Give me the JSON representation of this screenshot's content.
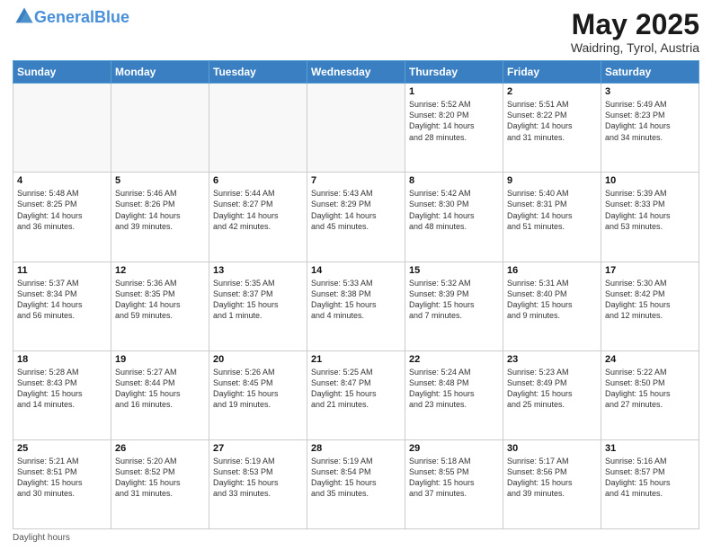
{
  "logo": {
    "line1": "General",
    "line2": "Blue"
  },
  "title": "May 2025",
  "subtitle": "Waidring, Tyrol, Austria",
  "days_of_week": [
    "Sunday",
    "Monday",
    "Tuesday",
    "Wednesday",
    "Thursday",
    "Friday",
    "Saturday"
  ],
  "weeks": [
    [
      {
        "day": "",
        "text": ""
      },
      {
        "day": "",
        "text": ""
      },
      {
        "day": "",
        "text": ""
      },
      {
        "day": "",
        "text": ""
      },
      {
        "day": "1",
        "text": "Sunrise: 5:52 AM\nSunset: 8:20 PM\nDaylight: 14 hours\nand 28 minutes."
      },
      {
        "day": "2",
        "text": "Sunrise: 5:51 AM\nSunset: 8:22 PM\nDaylight: 14 hours\nand 31 minutes."
      },
      {
        "day": "3",
        "text": "Sunrise: 5:49 AM\nSunset: 8:23 PM\nDaylight: 14 hours\nand 34 minutes."
      }
    ],
    [
      {
        "day": "4",
        "text": "Sunrise: 5:48 AM\nSunset: 8:25 PM\nDaylight: 14 hours\nand 36 minutes."
      },
      {
        "day": "5",
        "text": "Sunrise: 5:46 AM\nSunset: 8:26 PM\nDaylight: 14 hours\nand 39 minutes."
      },
      {
        "day": "6",
        "text": "Sunrise: 5:44 AM\nSunset: 8:27 PM\nDaylight: 14 hours\nand 42 minutes."
      },
      {
        "day": "7",
        "text": "Sunrise: 5:43 AM\nSunset: 8:29 PM\nDaylight: 14 hours\nand 45 minutes."
      },
      {
        "day": "8",
        "text": "Sunrise: 5:42 AM\nSunset: 8:30 PM\nDaylight: 14 hours\nand 48 minutes."
      },
      {
        "day": "9",
        "text": "Sunrise: 5:40 AM\nSunset: 8:31 PM\nDaylight: 14 hours\nand 51 minutes."
      },
      {
        "day": "10",
        "text": "Sunrise: 5:39 AM\nSunset: 8:33 PM\nDaylight: 14 hours\nand 53 minutes."
      }
    ],
    [
      {
        "day": "11",
        "text": "Sunrise: 5:37 AM\nSunset: 8:34 PM\nDaylight: 14 hours\nand 56 minutes."
      },
      {
        "day": "12",
        "text": "Sunrise: 5:36 AM\nSunset: 8:35 PM\nDaylight: 14 hours\nand 59 minutes."
      },
      {
        "day": "13",
        "text": "Sunrise: 5:35 AM\nSunset: 8:37 PM\nDaylight: 15 hours\nand 1 minute."
      },
      {
        "day": "14",
        "text": "Sunrise: 5:33 AM\nSunset: 8:38 PM\nDaylight: 15 hours\nand 4 minutes."
      },
      {
        "day": "15",
        "text": "Sunrise: 5:32 AM\nSunset: 8:39 PM\nDaylight: 15 hours\nand 7 minutes."
      },
      {
        "day": "16",
        "text": "Sunrise: 5:31 AM\nSunset: 8:40 PM\nDaylight: 15 hours\nand 9 minutes."
      },
      {
        "day": "17",
        "text": "Sunrise: 5:30 AM\nSunset: 8:42 PM\nDaylight: 15 hours\nand 12 minutes."
      }
    ],
    [
      {
        "day": "18",
        "text": "Sunrise: 5:28 AM\nSunset: 8:43 PM\nDaylight: 15 hours\nand 14 minutes."
      },
      {
        "day": "19",
        "text": "Sunrise: 5:27 AM\nSunset: 8:44 PM\nDaylight: 15 hours\nand 16 minutes."
      },
      {
        "day": "20",
        "text": "Sunrise: 5:26 AM\nSunset: 8:45 PM\nDaylight: 15 hours\nand 19 minutes."
      },
      {
        "day": "21",
        "text": "Sunrise: 5:25 AM\nSunset: 8:47 PM\nDaylight: 15 hours\nand 21 minutes."
      },
      {
        "day": "22",
        "text": "Sunrise: 5:24 AM\nSunset: 8:48 PM\nDaylight: 15 hours\nand 23 minutes."
      },
      {
        "day": "23",
        "text": "Sunrise: 5:23 AM\nSunset: 8:49 PM\nDaylight: 15 hours\nand 25 minutes."
      },
      {
        "day": "24",
        "text": "Sunrise: 5:22 AM\nSunset: 8:50 PM\nDaylight: 15 hours\nand 27 minutes."
      }
    ],
    [
      {
        "day": "25",
        "text": "Sunrise: 5:21 AM\nSunset: 8:51 PM\nDaylight: 15 hours\nand 30 minutes."
      },
      {
        "day": "26",
        "text": "Sunrise: 5:20 AM\nSunset: 8:52 PM\nDaylight: 15 hours\nand 31 minutes."
      },
      {
        "day": "27",
        "text": "Sunrise: 5:19 AM\nSunset: 8:53 PM\nDaylight: 15 hours\nand 33 minutes."
      },
      {
        "day": "28",
        "text": "Sunrise: 5:19 AM\nSunset: 8:54 PM\nDaylight: 15 hours\nand 35 minutes."
      },
      {
        "day": "29",
        "text": "Sunrise: 5:18 AM\nSunset: 8:55 PM\nDaylight: 15 hours\nand 37 minutes."
      },
      {
        "day": "30",
        "text": "Sunrise: 5:17 AM\nSunset: 8:56 PM\nDaylight: 15 hours\nand 39 minutes."
      },
      {
        "day": "31",
        "text": "Sunrise: 5:16 AM\nSunset: 8:57 PM\nDaylight: 15 hours\nand 41 minutes."
      }
    ]
  ],
  "footer": "Daylight hours"
}
